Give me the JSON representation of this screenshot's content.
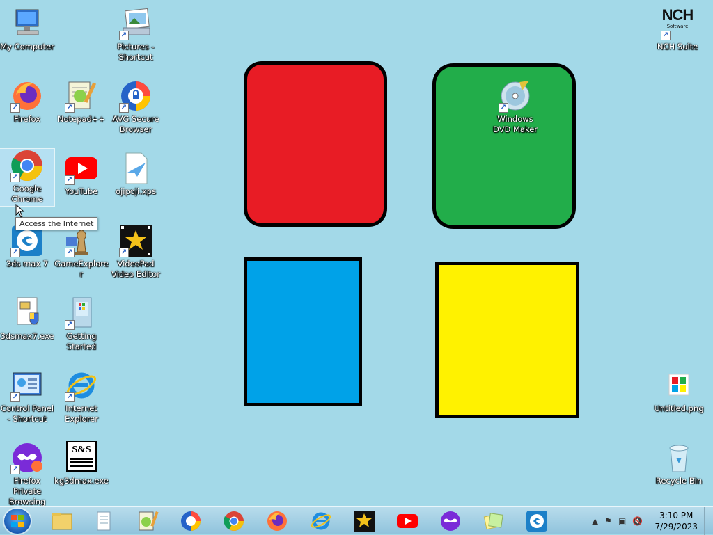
{
  "desktop": {
    "icons": {
      "my_computer": "My Computer",
      "pictures_shortcut": "Pictures - Shortcut",
      "nch_suite": "NCH Suite",
      "firefox": "Firefox",
      "notepadpp": "Notepad++",
      "avg_browser": "AVG Secure Browser",
      "windows_dvd_maker": "Windows DVD Maker",
      "google_chrome": "Google Chrome",
      "youtube": "YouTube",
      "ojipoji": "ojipoji.xps",
      "max3ds": "3ds max 7",
      "game_explorer": "GameExplorer",
      "videopad": "VideoPad Video Editor",
      "max_exe": "3dsmax7.exe",
      "getting_started": "Getting Started",
      "control_panel": "Control Panel - Shortcut",
      "internet_explorer": "Internet Explorer",
      "untitled_png": "Untitled.png",
      "firefox_private": "Firefox Private Browsing",
      "kg3dmax": "kg3dmax.exe",
      "recycle_bin": "Recycle Bin"
    },
    "nch_logo_text": "NCH",
    "nch_logo_sub": "Software",
    "sas_logo_text": "S&S",
    "tooltip": "Access the Internet"
  },
  "taskbar": {
    "clock_time": "3:10 PM",
    "clock_date": "7/29/2023",
    "pinned": [
      "file-explorer",
      "documents",
      "notepadpp",
      "avg-browser",
      "chrome",
      "firefox",
      "internet-explorer",
      "videopad",
      "youtube",
      "firefox-private",
      "sticky-notes",
      "3ds-max"
    ]
  },
  "colors": {
    "wallpaper": "#a3d9e8",
    "red_tile": "#e81c25",
    "green_tile": "#22ad4a",
    "blue_tile": "#00a2e8",
    "yellow_tile": "#fff200"
  }
}
